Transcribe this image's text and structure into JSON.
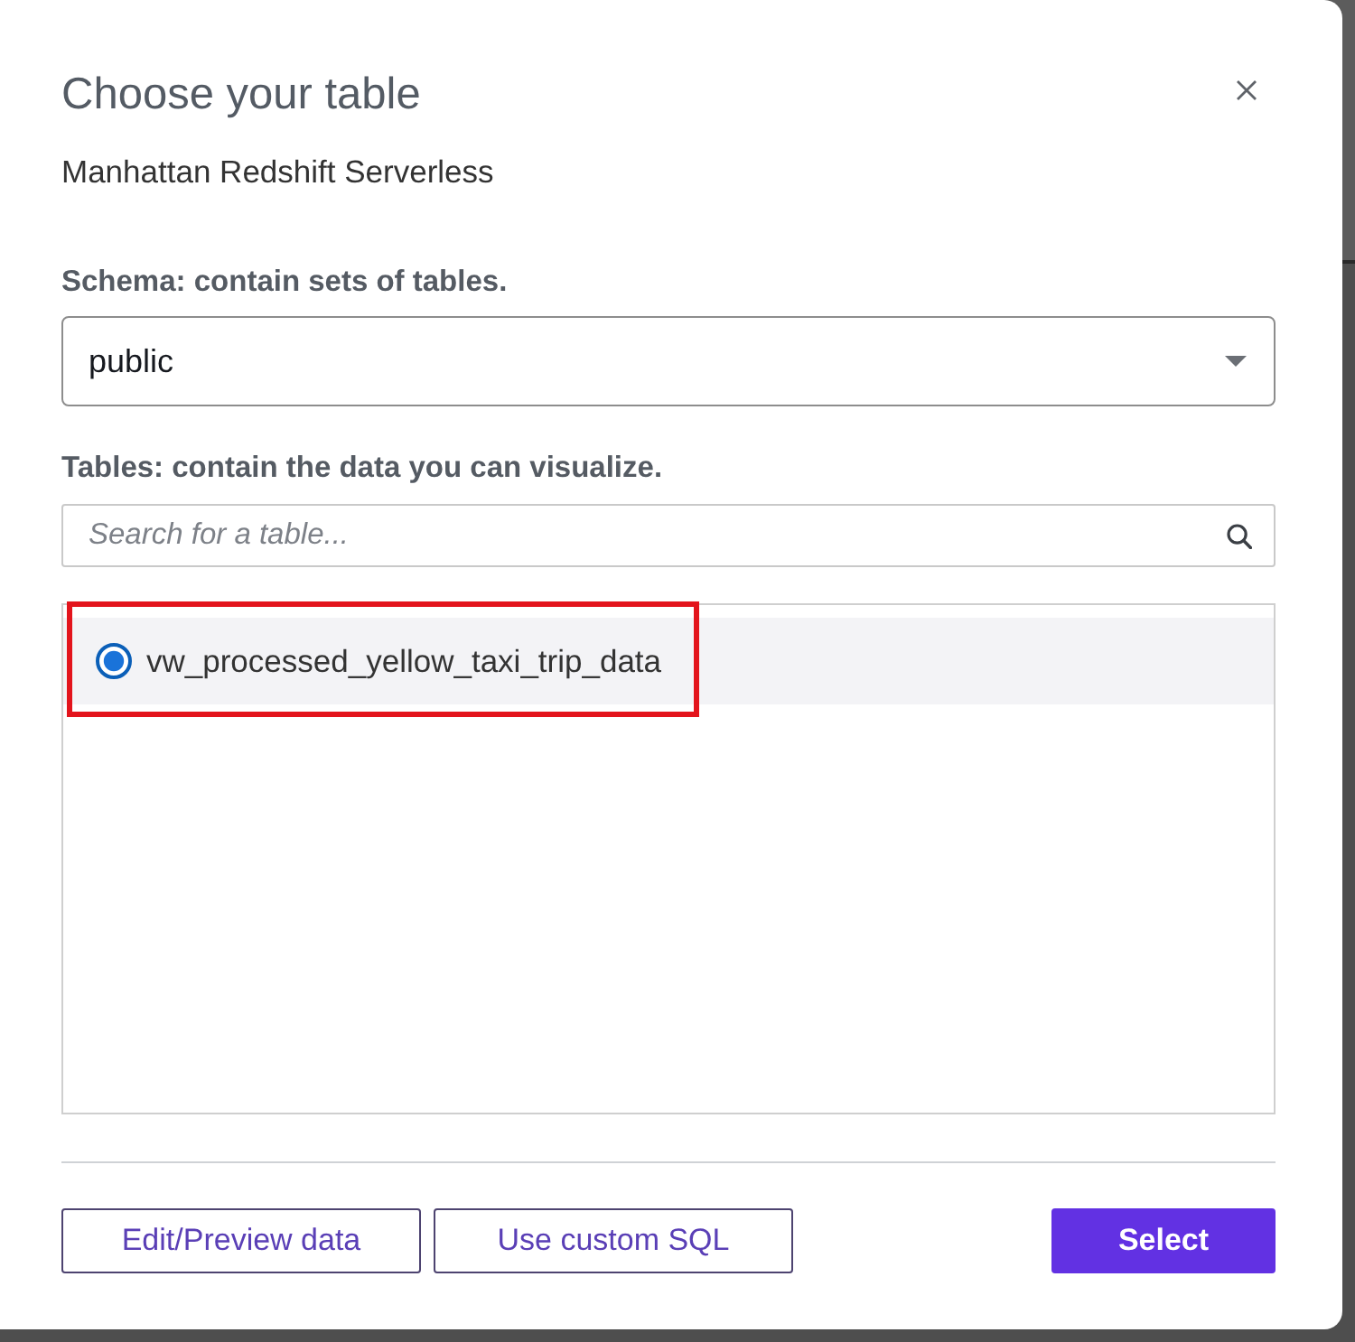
{
  "dialog": {
    "title": "Choose your table",
    "subtitle": "Manhattan Redshift Serverless"
  },
  "schema": {
    "label": "Schema: contain sets of tables.",
    "value": "public"
  },
  "tables": {
    "label": "Tables: contain the data you can visualize.",
    "search": {
      "placeholder": "Search for a table..."
    },
    "items": [
      {
        "name": "vw_processed_yellow_taxi_trip_data",
        "selected": true,
        "annotated": true
      }
    ]
  },
  "buttons": [
    {
      "label": "Edit/Preview data",
      "kind": "secondary"
    },
    {
      "label": "Use custom SQL",
      "kind": "secondary"
    },
    {
      "label": "Select",
      "kind": "primary"
    }
  ]
}
